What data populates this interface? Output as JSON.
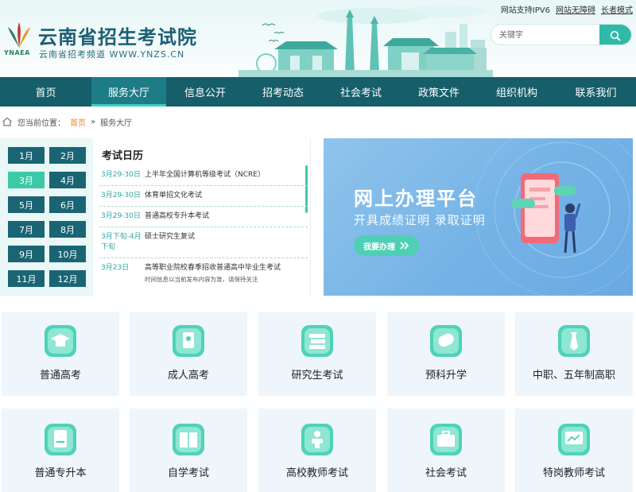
{
  "header": {
    "title": "云南省招生考试院",
    "subtitle": "云南省招考频道 WWW.YNZS.CN",
    "logo_text": "YNAEA",
    "top_links": [
      "网站支持IPV6",
      "网站无障碍",
      "长者模式"
    ]
  },
  "search": {
    "placeholder": "关键字",
    "button_icon": "search-icon"
  },
  "nav": {
    "items": [
      "首页",
      "服务大厅",
      "信息公开",
      "招考动态",
      "社会考试",
      "政策文件",
      "组织机构",
      "联系我们"
    ],
    "active_index": 1
  },
  "breadcrumb": {
    "prefix": "您当前位置：",
    "home": "首页",
    "separator": "»",
    "current": "服务大厅"
  },
  "months": {
    "items": [
      "1月",
      "2月",
      "3月",
      "4月",
      "5月",
      "6月",
      "7月",
      "8月",
      "9月",
      "10月",
      "11月",
      "12月"
    ],
    "active_index": 2
  },
  "calendar": {
    "title": "考试日历",
    "items": [
      {
        "date": "3月29-30日",
        "title": "上半年全国计算机等级考试（NCRE）"
      },
      {
        "date": "3月29-30日",
        "title": "体育单招文化考试"
      },
      {
        "date": "3月29-30日",
        "title": "普通高校专升本考试"
      },
      {
        "date": "3月下旬-4月下旬",
        "title": "硕士研究生复试"
      },
      {
        "date": "3月23日",
        "title": "高等职业院校春季招收普通高中毕业生考试"
      }
    ],
    "note": "时间信息以当前发布内容为准，请保持关注"
  },
  "banner": {
    "title": "网上办理平台",
    "subtitle": "开具成绩证明 录取证明",
    "button": "我要办理"
  },
  "services": [
    {
      "label": "普通高考",
      "icon": "graduation-cap-icon"
    },
    {
      "label": "成人高考",
      "icon": "certificate-icon"
    },
    {
      "label": "研究生考试",
      "icon": "books-icon"
    },
    {
      "label": "预科升学",
      "icon": "diploma-icon"
    },
    {
      "label": "中职、五年制高职",
      "icon": "tie-icon"
    },
    {
      "label": "普通专升本",
      "icon": "exam-paper-icon"
    },
    {
      "label": "自学考试",
      "icon": "open-book-icon"
    },
    {
      "label": "高校教师考试",
      "icon": "teacher-icon"
    },
    {
      "label": "社会考试",
      "icon": "briefcase-icon"
    },
    {
      "label": "特岗教师考试",
      "icon": "board-icon"
    }
  ],
  "colors": {
    "nav": "#155e6a",
    "accent": "#3dc9a8",
    "month": "#1a6474",
    "banner": "#7ab6e8"
  }
}
